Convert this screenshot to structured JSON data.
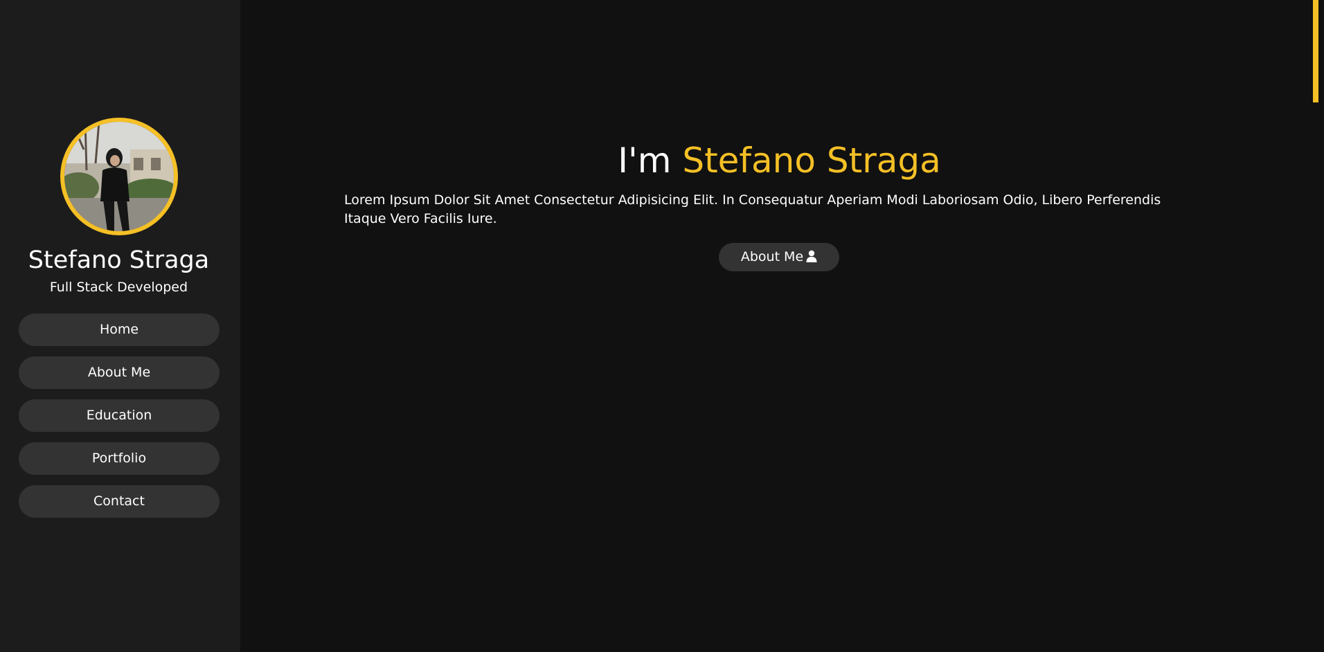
{
  "sidebar": {
    "profile": {
      "name": "Stefano Straga",
      "role": "Full Stack Developed",
      "avatar_icon": "profile-photo"
    },
    "nav": [
      {
        "label": "Home"
      },
      {
        "label": "About Me"
      },
      {
        "label": "Education"
      },
      {
        "label": "Portfolio"
      },
      {
        "label": "Contact"
      }
    ]
  },
  "hero": {
    "title_prefix": "I'm ",
    "title_name": "Stefano Straga",
    "text": "Lorem Ipsum Dolor Sit Amet Consectetur Adipisicing Elit. In Consequatur Aperiam Modi Laboriosam Odio, Libero Perferendis Itaque Vero Facilis Iure.",
    "button_label": "About Me",
    "button_icon": "user-icon"
  },
  "colors": {
    "accent": "#f5c026",
    "sidebar_bg": "#1c1c1c",
    "main_bg": "#111111",
    "button_bg": "#333333"
  }
}
